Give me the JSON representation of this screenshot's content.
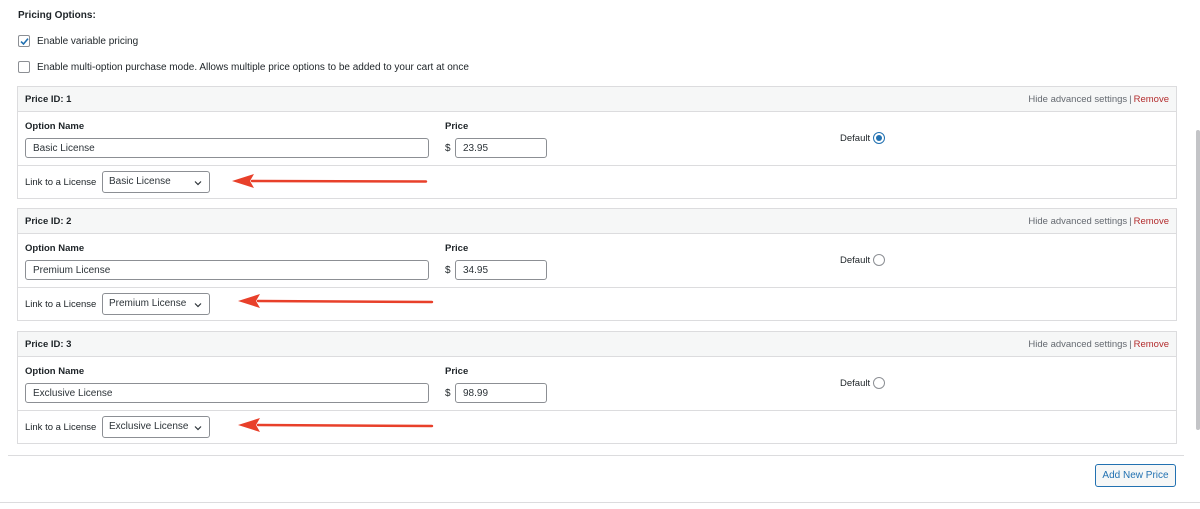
{
  "heading": "Pricing Options:",
  "options": {
    "variable_pricing": {
      "label": "Enable variable pricing",
      "checked": true
    },
    "multi_option": {
      "label": "Enable multi-option purchase mode. Allows multiple price options to be added to your cart at once",
      "checked": false
    }
  },
  "common": {
    "hide_advanced": "Hide advanced settings",
    "separator": "|",
    "remove": "Remove",
    "option_name_label": "Option Name",
    "price_label": "Price",
    "currency": "$",
    "default_label": "Default",
    "link_label": "Link to a License"
  },
  "prices": [
    {
      "title": "Price ID: 1",
      "option_name": "Basic License",
      "price": "23.95",
      "license": "Basic License",
      "is_default": true
    },
    {
      "title": "Price ID: 2",
      "option_name": "Premium License",
      "price": "34.95",
      "license": "Premium License",
      "is_default": false
    },
    {
      "title": "Price ID: 3",
      "option_name": "Exclusive License",
      "price": "98.99",
      "license": "Exclusive License",
      "is_default": false
    }
  ],
  "add_button": "Add New Price",
  "colors": {
    "accent": "#2271b1",
    "remove": "#b32d2e",
    "arrow": "#e8402a"
  }
}
